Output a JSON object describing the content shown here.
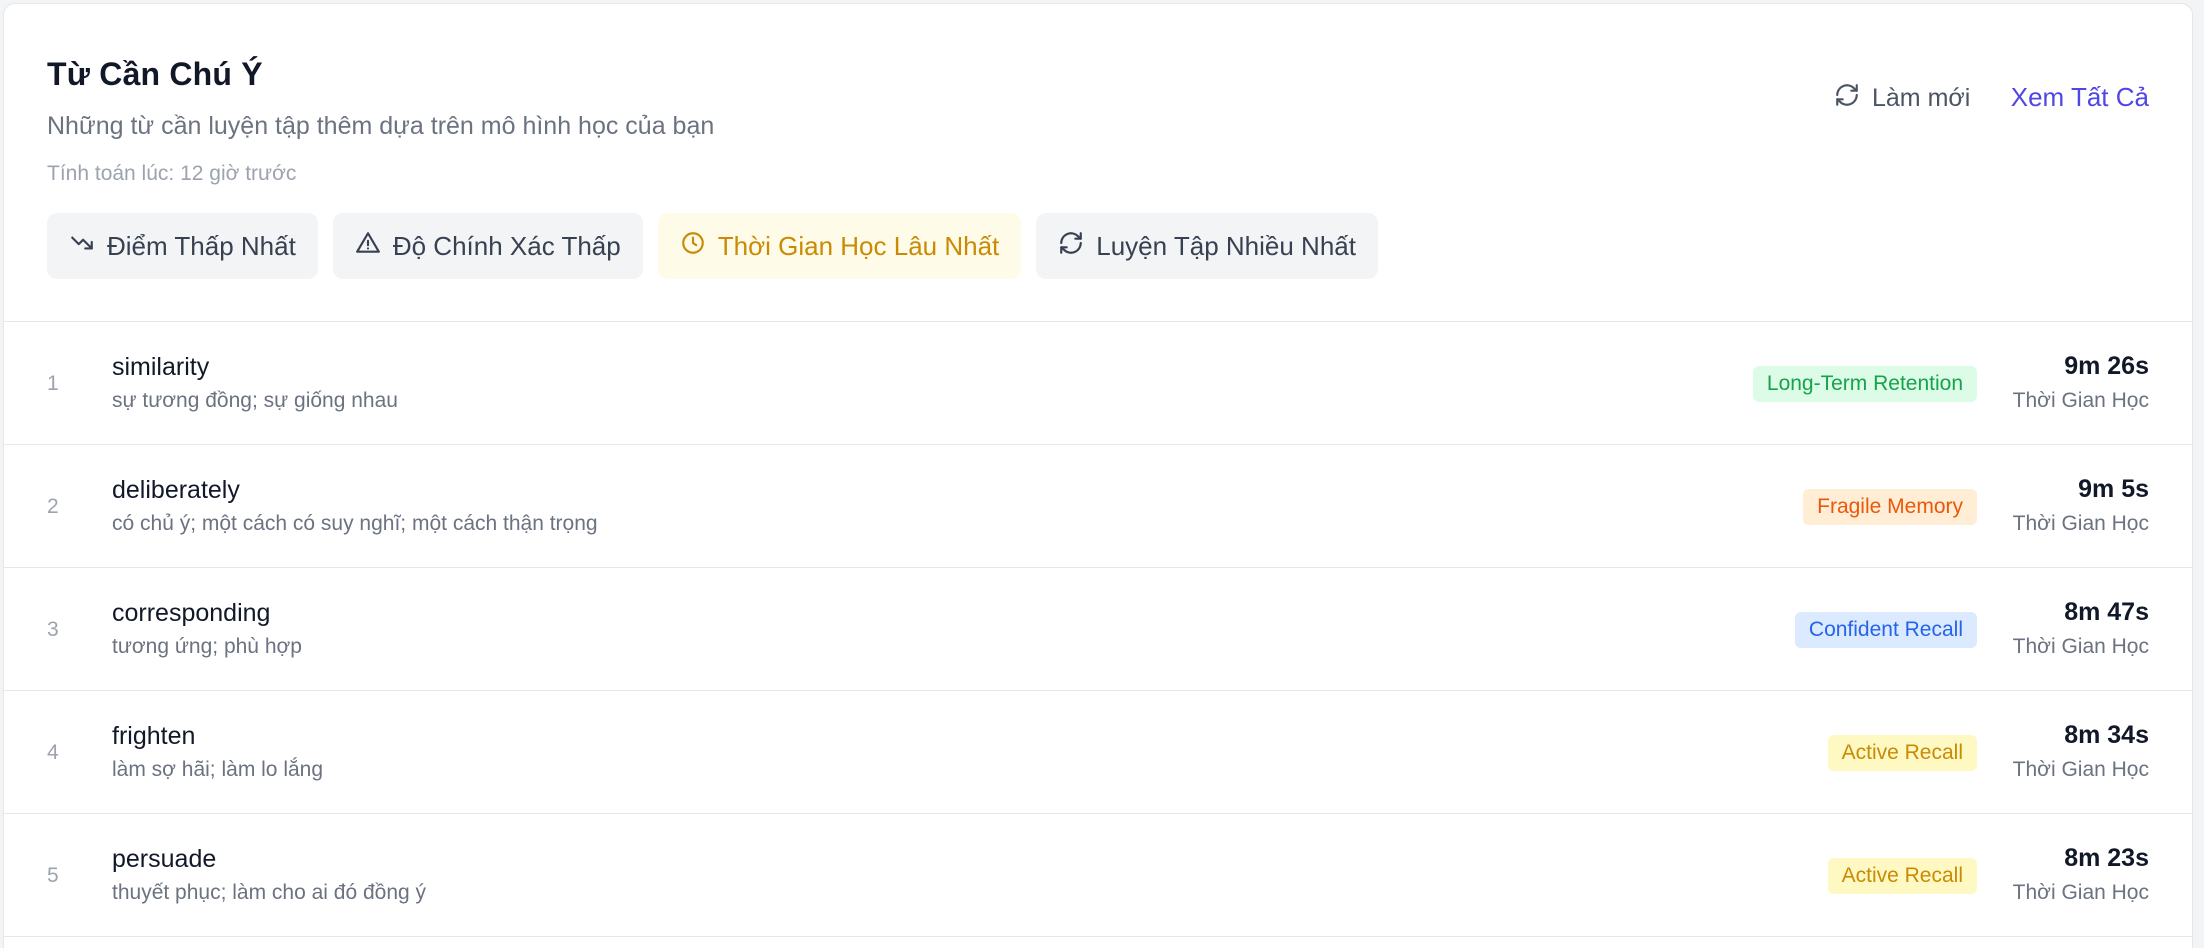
{
  "header": {
    "title": "Từ Cần Chú Ý",
    "subtitle": "Những từ cần luyện tập thêm dựa trên mô hình học của bạn",
    "computed_at": "Tính toán lúc: 12 giờ trước",
    "refresh_label": "Làm mới",
    "view_all_label": "Xem Tất Cả"
  },
  "tabs": [
    {
      "label": "Điểm Thấp Nhất",
      "icon": "trending-down-icon",
      "active": false
    },
    {
      "label": "Độ Chính Xác Thấp",
      "icon": "warning-triangle-icon",
      "active": false
    },
    {
      "label": "Thời Gian Học Lâu Nhất",
      "icon": "clock-icon",
      "active": true
    },
    {
      "label": "Luyện Tập Nhiều Nhất",
      "icon": "refresh-icon",
      "active": false
    }
  ],
  "colors": {
    "accent": "#4f46e5",
    "active_tab_bg": "#fefce8",
    "active_tab_text": "#ca8a04"
  },
  "words": [
    {
      "rank": "1",
      "word": "similarity",
      "meaning": "sự tương đồng; sự giống nhau",
      "badge": "Long-Term Retention",
      "badge_bg": "#dcfce7",
      "badge_color": "#16a34a",
      "time": "9m 26s",
      "time_label": "Thời Gian Học"
    },
    {
      "rank": "2",
      "word": "deliberately",
      "meaning": "có chủ ý; một cách có suy nghĩ; một cách thận trọng",
      "badge": "Fragile Memory",
      "badge_bg": "#ffedd5",
      "badge_color": "#ea580c",
      "time": "9m 5s",
      "time_label": "Thời Gian Học"
    },
    {
      "rank": "3",
      "word": "corresponding",
      "meaning": "tương ứng; phù hợp",
      "badge": "Confident Recall",
      "badge_bg": "#dbeafe",
      "badge_color": "#2563eb",
      "time": "8m 47s",
      "time_label": "Thời Gian Học"
    },
    {
      "rank": "4",
      "word": "frighten",
      "meaning": "làm sợ hãi; làm lo lắng",
      "badge": "Active Recall",
      "badge_bg": "#fef9c3",
      "badge_color": "#ca8a04",
      "time": "8m 34s",
      "time_label": "Thời Gian Học"
    },
    {
      "rank": "5",
      "word": "persuade",
      "meaning": "thuyết phục; làm cho ai đó đồng ý",
      "badge": "Active Recall",
      "badge_bg": "#fef9c3",
      "badge_color": "#ca8a04",
      "time": "8m 23s",
      "time_label": "Thời Gian Học"
    }
  ]
}
